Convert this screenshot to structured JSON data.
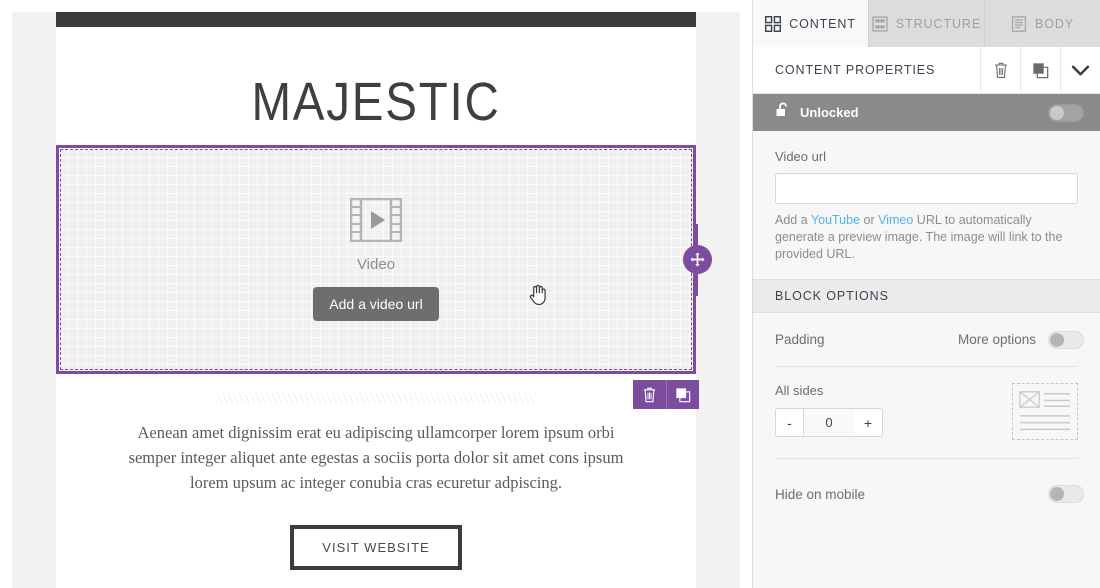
{
  "canvas": {
    "hero_title": "MAJESTIC",
    "video_block": {
      "icon": "film-strip-play-icon",
      "caption": "Video",
      "button_label": "Add a video url"
    },
    "toolbar": {
      "delete_icon": "trash-icon",
      "duplicate_icon": "duplicate-icon",
      "move_icon": "move-arrows-icon"
    },
    "body_copy": "Aenean amet dignissim erat eu adipiscing ullamcorper lorem ipsum orbi semper integer aliquet ante egestas a sociis porta dolor sit amet cons ipsum lorem upsum ac integer conubia cras ecuretur adpiscing.",
    "cta_label": "VISIT WEBSITE",
    "cursor": "pointing-hand-cursor"
  },
  "panel": {
    "tabs": [
      {
        "label": "CONTENT",
        "icon": "grid-blocks-icon",
        "active": true
      },
      {
        "label": "STRUCTURE",
        "icon": "rows-stack-icon",
        "active": false
      },
      {
        "label": "BODY",
        "icon": "document-icon",
        "active": false
      }
    ],
    "properties_header": {
      "title": "CONTENT PROPERTIES",
      "delete_icon": "trash-icon",
      "duplicate_icon": "duplicate-icon",
      "collapse_icon": "chevron-down-icon"
    },
    "lock_bar": {
      "label": "Unlocked",
      "icon": "unlocked-padlock-icon",
      "toggle_state": "off"
    },
    "video_url": {
      "label": "Video url",
      "value": "",
      "placeholder": "",
      "help_prefix": "Add a ",
      "help_link_youtube": "YouTube",
      "help_middle": " or ",
      "help_link_vimeo": "Vimeo",
      "help_suffix": " URL to automatically generate a preview image. The image will link to the provided URL."
    },
    "block_options": {
      "section_title": "BLOCK OPTIONS",
      "padding_label": "Padding",
      "more_options_label": "More options",
      "more_options_state": "off",
      "all_sides_label": "All sides",
      "padding_value": "0",
      "minus_label": "-",
      "plus_label": "+",
      "preview_icon": "padding-preview-icon",
      "hide_on_mobile_label": "Hide on mobile",
      "hide_on_mobile_state": "off"
    }
  },
  "colors": {
    "accent_purple": "#7c4d9e",
    "link_blue": "#4fb4e8",
    "dark_bar": "#3c3c3c",
    "panel_bg": "#f7f7f7",
    "tab_inactive": "#dcdcdc"
  }
}
